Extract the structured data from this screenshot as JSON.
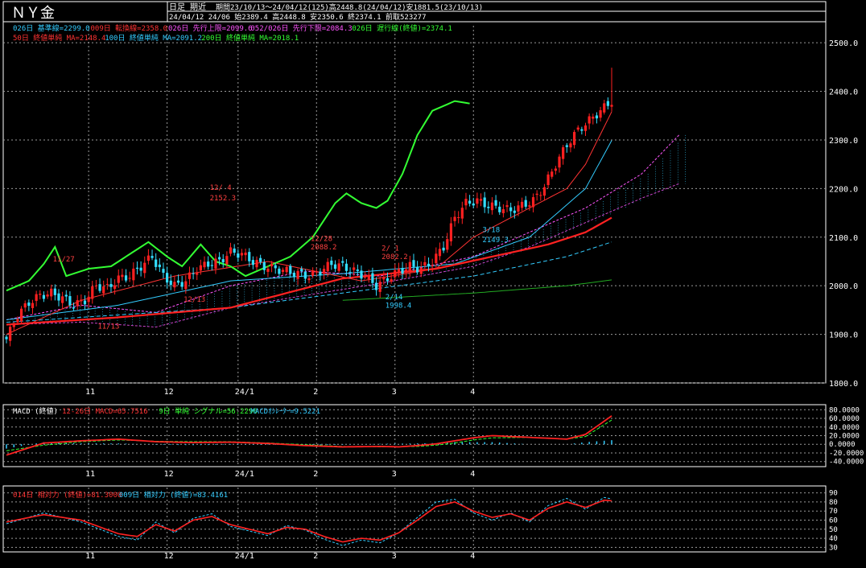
{
  "header": {
    "title": "ＮＹ金",
    "mode": "日足 期近",
    "period": "期間23/10/13～24/04/12(125)高2448.8(24/04/12)安1881.5(23/10/13)",
    "ohlc": "24/04/12 24/06 始2389.4 高2448.8 安2350.6 終2374.1 前取523277"
  },
  "legend": {
    "l1": [
      {
        "text": "026日 基準線=2299.0",
        "color": "#33ccff"
      },
      {
        "text": "009日 転換線=2358.0",
        "color": "#ff3333"
      },
      {
        "text": "026日 先行上限=2099.6",
        "color": "#ff55ff"
      },
      {
        "text": "052/026日 先行下限=2084.3",
        "color": "#ff55ff"
      },
      {
        "text": "026日 遅行線(終値)=2374.1",
        "color": "#33ff33"
      }
    ],
    "l2": [
      {
        "text": "50日 終値単純 MA=2148.4",
        "color": "#ff3333"
      },
      {
        "text": "100日 終値単純 MA=2091.2",
        "color": "#33ccff"
      },
      {
        "text": "200日 終値単純 MA=2018.1",
        "color": "#33ff33"
      }
    ]
  },
  "macd_legend": [
    {
      "text": "MACD (終値)",
      "color": "#ffffff"
    },
    {
      "text": "12-26日 MACD=65.7516",
      "color": "#ff3333"
    },
    {
      "text": "9日 単純 シグナル=56.2296",
      "color": "#33ff33"
    },
    {
      "text": "MACDｵｼﾚｰﾀｰ=9.5221",
      "color": "#33ccff"
    }
  ],
  "rsi_legend": [
    {
      "text": "014日 相対力 (終値)=81.3000",
      "color": "#ff3333"
    },
    {
      "text": "009日 相対力 (終値)=83.4161",
      "color": "#33ccff"
    }
  ],
  "x_ticks": [
    "11",
    "12",
    "24/1",
    "2",
    "3",
    "4"
  ],
  "price_ticks": [
    "2500.0",
    "2400.0",
    "2300.0",
    "2200.0",
    "2100.0",
    "2000.0",
    "1900.0",
    "1800.0"
  ],
  "macd_ticks": [
    "80.0000",
    "60.0000",
    "40.0000",
    "20.0000",
    "0.0000",
    "-20.0000",
    "-40.0000"
  ],
  "rsi_ticks": [
    "90",
    "80",
    "70",
    "60",
    "50",
    "40",
    "30"
  ],
  "annotations": [
    {
      "text": "12/ 4",
      "price": 2197
    },
    {
      "text": "2152.3",
      "price": 2176
    },
    {
      "text": "12/28",
      "price": 2092
    },
    {
      "text": "2088.2",
      "price": 2075
    },
    {
      "text": "2/ 1",
      "price": 2072
    },
    {
      "text": "2082.2",
      "price": 2055
    },
    {
      "text": "2/14",
      "price": 1972
    },
    {
      "text": "1998.4",
      "price": 1955
    },
    {
      "text": "3/18",
      "price": 2110
    },
    {
      "text": "2149.3",
      "price": 2090
    },
    {
      "text": "11/27",
      "price": 2050
    },
    {
      "text": "11/13",
      "price": 1912
    },
    {
      "text": "12/13",
      "price": 1967
    }
  ],
  "chart_data": [
    {
      "type": "candlestick",
      "title": "ＮＹ金",
      "x_range": [
        "23/10/13",
        "24/04/12"
      ],
      "ylim": [
        1800,
        2500
      ],
      "high": 2448.8,
      "low": 1881.5,
      "close_path": [
        [
          0,
          1890
        ],
        [
          3,
          1940
        ],
        [
          6,
          1965
        ],
        [
          9,
          1980
        ],
        [
          12,
          1985
        ],
        [
          15,
          1975
        ],
        [
          18,
          1960
        ],
        [
          21,
          1970
        ],
        [
          24,
          2000
        ],
        [
          27,
          1995
        ],
        [
          30,
          2015
        ],
        [
          33,
          2020
        ],
        [
          36,
          2040
        ],
        [
          39,
          2060
        ],
        [
          42,
          2020
        ],
        [
          45,
          2000
        ],
        [
          48,
          2010
        ],
        [
          51,
          2035
        ],
        [
          54,
          2045
        ],
        [
          57,
          2050
        ],
        [
          60,
          2070
        ],
        [
          63,
          2065
        ],
        [
          66,
          2050
        ],
        [
          69,
          2040
        ],
        [
          72,
          2035
        ],
        [
          75,
          2030
        ],
        [
          78,
          2025
        ],
        [
          81,
          2020
        ],
        [
          84,
          2030
        ],
        [
          87,
          2045
        ],
        [
          90,
          2040
        ],
        [
          93,
          2030
        ],
        [
          96,
          2020
        ],
        [
          99,
          2000
        ],
        [
          102,
          2015
        ],
        [
          105,
          2030
        ],
        [
          108,
          2040
        ],
        [
          111,
          2035
        ],
        [
          114,
          2050
        ],
        [
          117,
          2080
        ],
        [
          120,
          2140
        ],
        [
          123,
          2170
        ],
        [
          126,
          2175
        ],
        [
          129,
          2165
        ],
        [
          132,
          2160
        ],
        [
          135,
          2155
        ],
        [
          138,
          2165
        ],
        [
          141,
          2175
        ],
        [
          144,
          2205
        ],
        [
          147,
          2250
        ],
        [
          150,
          2290
        ],
        [
          153,
          2320
        ],
        [
          156,
          2340
        ],
        [
          159,
          2360
        ],
        [
          162,
          2380
        ]
      ],
      "sma_50_path": [
        [
          0,
          1920
        ],
        [
          30,
          1935
        ],
        [
          60,
          1955
        ],
        [
          90,
          2015
        ],
        [
          115,
          2035
        ],
        [
          130,
          2060
        ],
        [
          145,
          2085
        ],
        [
          155,
          2110
        ],
        [
          162,
          2140
        ]
      ],
      "sma_100_path": [
        [
          0,
          1925
        ],
        [
          60,
          1955
        ],
        [
          100,
          1995
        ],
        [
          125,
          2020
        ],
        [
          150,
          2060
        ],
        [
          162,
          2090
        ]
      ],
      "sma_200_path": [
        [
          90,
          1970
        ],
        [
          125,
          1985
        ],
        [
          150,
          2000
        ],
        [
          162,
          2012
        ]
      ],
      "tenkan_path": [
        [
          0,
          1900
        ],
        [
          20,
          1970
        ],
        [
          45,
          2020
        ],
        [
          70,
          2050
        ],
        [
          95,
          2010
        ],
        [
          115,
          2035
        ],
        [
          125,
          2100
        ],
        [
          140,
          2160
        ],
        [
          150,
          2200
        ],
        [
          155,
          2250
        ],
        [
          162,
          2358
        ]
      ],
      "kijun_path": [
        [
          0,
          1930
        ],
        [
          30,
          1960
        ],
        [
          60,
          2010
        ],
        [
          90,
          2025
        ],
        [
          120,
          2045
        ],
        [
          140,
          2100
        ],
        [
          155,
          2200
        ],
        [
          162,
          2299
        ]
      ],
      "chikou_path": [
        [
          0,
          1990
        ],
        [
          6,
          2010
        ],
        [
          10,
          2045
        ],
        [
          13,
          2080
        ],
        [
          16,
          2020
        ],
        [
          22,
          2035
        ],
        [
          28,
          2040
        ],
        [
          34,
          2070
        ],
        [
          38,
          2090
        ],
        [
          43,
          2060
        ],
        [
          47,
          2040
        ],
        [
          52,
          2085
        ],
        [
          56,
          2050
        ],
        [
          60,
          2040
        ],
        [
          64,
          2020
        ],
        [
          70,
          2040
        ],
        [
          76,
          2060
        ],
        [
          82,
          2100
        ],
        [
          88,
          2170
        ],
        [
          91,
          2190
        ],
        [
          95,
          2170
        ],
        [
          99,
          2160
        ],
        [
          102,
          2175
        ],
        [
          106,
          2230
        ],
        [
          110,
          2310
        ],
        [
          114,
          2360
        ],
        [
          120,
          2380
        ],
        [
          124,
          2375
        ]
      ],
      "senkou_a_path": [
        [
          0,
          1930
        ],
        [
          20,
          1960
        ],
        [
          40,
          1945
        ],
        [
          60,
          2000
        ],
        [
          80,
          2030
        ],
        [
          100,
          2020
        ],
        [
          125,
          2060
        ],
        [
          140,
          2110
        ],
        [
          155,
          2160
        ],
        [
          170,
          2230
        ],
        [
          180,
          2310
        ]
      ],
      "senkou_b_path": [
        [
          0,
          1920
        ],
        [
          20,
          1925
        ],
        [
          40,
          1915
        ],
        [
          60,
          1955
        ],
        [
          80,
          1980
        ],
        [
          100,
          2005
        ],
        [
          125,
          2040
        ],
        [
          140,
          2080
        ],
        [
          155,
          2130
        ],
        [
          170,
          2180
        ],
        [
          180,
          2210
        ]
      ]
    },
    {
      "type": "line",
      "title": "MACD (終値)",
      "ylim": [
        -40,
        80
      ],
      "macd_path": [
        [
          0,
          -25
        ],
        [
          10,
          3
        ],
        [
          20,
          8
        ],
        [
          30,
          12
        ],
        [
          40,
          6
        ],
        [
          50,
          4
        ],
        [
          60,
          5
        ],
        [
          70,
          2
        ],
        [
          80,
          -3
        ],
        [
          90,
          -6
        ],
        [
          100,
          -5
        ],
        [
          105,
          -6
        ],
        [
          110,
          -3
        ],
        [
          115,
          1
        ],
        [
          120,
          8
        ],
        [
          125,
          15
        ],
        [
          130,
          20
        ],
        [
          140,
          16
        ],
        [
          150,
          12
        ],
        [
          155,
          23
        ],
        [
          162,
          65.75
        ]
      ],
      "signal_path": [
        [
          0,
          -15
        ],
        [
          10,
          -2
        ],
        [
          20,
          6
        ],
        [
          30,
          10
        ],
        [
          40,
          7
        ],
        [
          50,
          6
        ],
        [
          60,
          6
        ],
        [
          70,
          3
        ],
        [
          80,
          -1
        ],
        [
          90,
          -5
        ],
        [
          100,
          -6
        ],
        [
          110,
          -5
        ],
        [
          115,
          -2
        ],
        [
          120,
          3
        ],
        [
          125,
          10
        ],
        [
          130,
          15
        ],
        [
          140,
          16
        ],
        [
          150,
          12
        ],
        [
          155,
          18
        ],
        [
          162,
          56.23
        ]
      ],
      "oscillator_path": [
        [
          0,
          -10
        ],
        [
          10,
          5
        ],
        [
          20,
          2
        ],
        [
          30,
          2
        ],
        [
          40,
          -1
        ],
        [
          50,
          -2
        ],
        [
          60,
          -1
        ],
        [
          70,
          -1
        ],
        [
          80,
          -2
        ],
        [
          90,
          -1
        ],
        [
          100,
          1
        ],
        [
          110,
          2
        ],
        [
          115,
          3
        ],
        [
          120,
          5
        ],
        [
          125,
          5
        ],
        [
          130,
          5
        ],
        [
          140,
          0
        ],
        [
          150,
          0
        ],
        [
          155,
          5
        ],
        [
          162,
          9.52
        ]
      ]
    },
    {
      "type": "line",
      "title": "相対力 (終値)",
      "ylim": [
        25,
        90
      ],
      "rsi14_path": [
        [
          0,
          58
        ],
        [
          10,
          66
        ],
        [
          20,
          60
        ],
        [
          30,
          45
        ],
        [
          35,
          42
        ],
        [
          40,
          55
        ],
        [
          45,
          48
        ],
        [
          50,
          60
        ],
        [
          55,
          64
        ],
        [
          60,
          55
        ],
        [
          65,
          50
        ],
        [
          70,
          45
        ],
        [
          75,
          52
        ],
        [
          80,
          50
        ],
        [
          85,
          42
        ],
        [
          90,
          36
        ],
        [
          95,
          40
        ],
        [
          100,
          38
        ],
        [
          105,
          46
        ],
        [
          110,
          60
        ],
        [
          115,
          75
        ],
        [
          120,
          80
        ],
        [
          125,
          70
        ],
        [
          130,
          63
        ],
        [
          135,
          67
        ],
        [
          140,
          60
        ],
        [
          145,
          73
        ],
        [
          150,
          80
        ],
        [
          155,
          74
        ],
        [
          160,
          82
        ],
        [
          162,
          81.3
        ]
      ],
      "rsi9_path": [
        [
          0,
          56
        ],
        [
          10,
          68
        ],
        [
          20,
          58
        ],
        [
          30,
          42
        ],
        [
          35,
          38
        ],
        [
          40,
          58
        ],
        [
          45,
          46
        ],
        [
          50,
          62
        ],
        [
          55,
          67
        ],
        [
          60,
          53
        ],
        [
          65,
          48
        ],
        [
          70,
          43
        ],
        [
          75,
          54
        ],
        [
          80,
          49
        ],
        [
          85,
          39
        ],
        [
          90,
          32
        ],
        [
          95,
          38
        ],
        [
          100,
          35
        ],
        [
          105,
          46
        ],
        [
          110,
          63
        ],
        [
          115,
          80
        ],
        [
          120,
          83
        ],
        [
          125,
          68
        ],
        [
          130,
          60
        ],
        [
          135,
          68
        ],
        [
          140,
          58
        ],
        [
          145,
          76
        ],
        [
          150,
          84
        ],
        [
          155,
          72
        ],
        [
          160,
          85
        ],
        [
          162,
          83.4
        ]
      ]
    }
  ]
}
